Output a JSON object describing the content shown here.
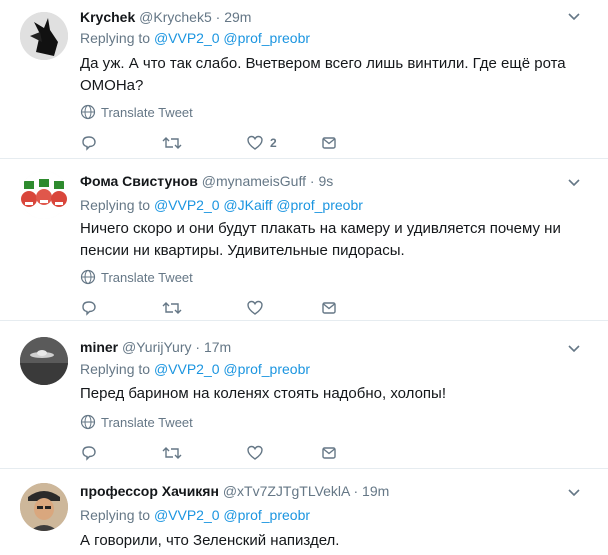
{
  "replying_to_label": "Replying to",
  "translate_label": "Translate Tweet",
  "tweets": [
    {
      "name": "Krychek",
      "handle": "@Krychek5",
      "sep": "·",
      "time": "29m",
      "mentions": [
        "@VVP2_0",
        "@prof_preobr"
      ],
      "text": "Да уж. А что так слабо. Вчетвером всего лишь винтили. Где ещё рота ОМОНа?",
      "likes": "2"
    },
    {
      "name": "Фома Свистунов",
      "handle": "@mynameisGuff",
      "sep": "·",
      "time": "9s",
      "mentions": [
        "@VVP2_0",
        "@JKaiff",
        "@prof_preobr"
      ],
      "text": "Ничего скоро и они будут плакать на камеру и удивляется почему ни пенсии ни квартиры. Удивительные пидорасы."
    },
    {
      "name": "miner",
      "handle": "@YurijYury",
      "sep": "·",
      "time": "17m",
      "mentions": [
        "@VVP2_0",
        "@prof_preobr"
      ],
      "text": "Перед барином на коленях стоять надобно, холопы!"
    },
    {
      "name": "профессор Хачикян",
      "handle": "@xTv7ZJTgTLVeklA",
      "sep": "·",
      "time": "19m",
      "mentions": [
        "@VVP2_0",
        "@prof_preobr"
      ],
      "text": "А говорили, что Зеленский напиздел."
    }
  ]
}
